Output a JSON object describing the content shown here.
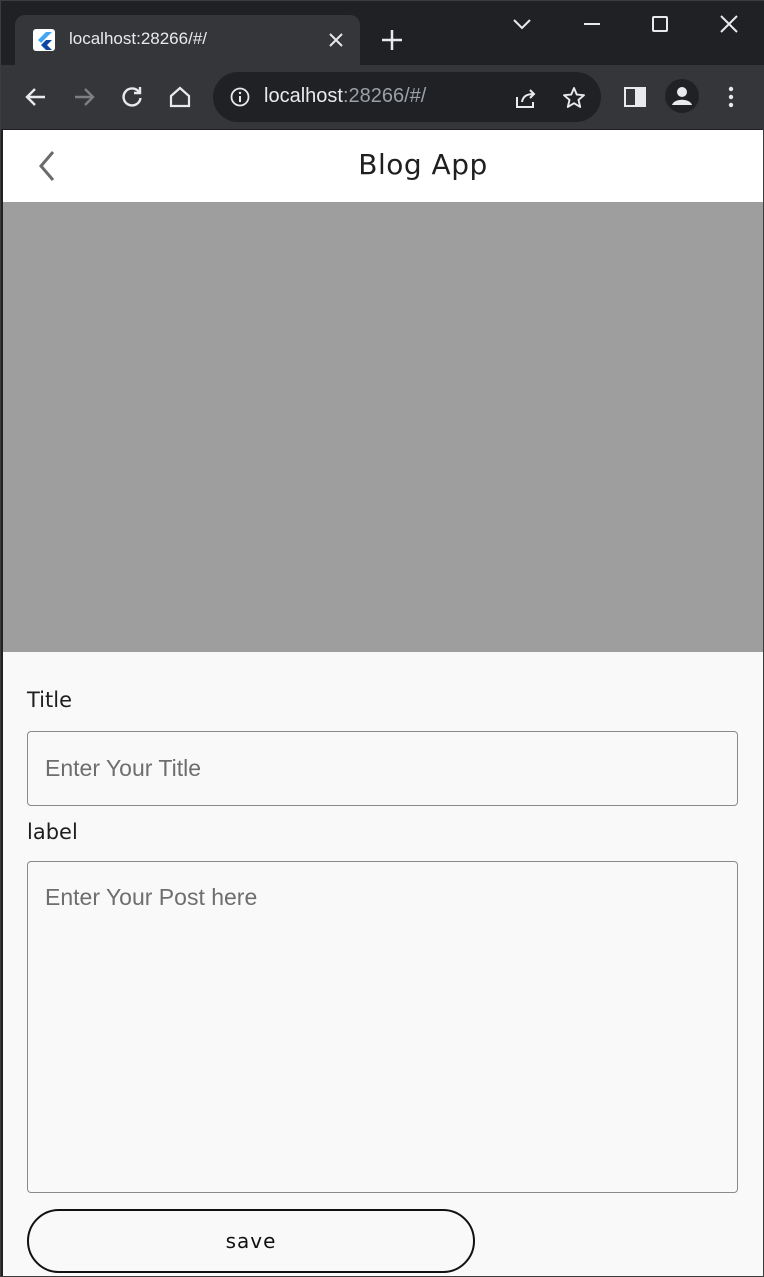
{
  "browser": {
    "tab": {
      "title": "localhost:28266/#/"
    },
    "omnibox": {
      "host": "localhost",
      "path": ":28266/#/"
    }
  },
  "icons": {
    "tab_favicon": "flutter-icon",
    "tab_close": "close-icon",
    "new_tab": "plus-icon",
    "tab_search": "chevron-down-icon",
    "minimize": "minimize-icon",
    "maximize": "maximize-icon",
    "close_window": "close-icon",
    "back": "arrow-left-icon",
    "forward": "arrow-right-icon",
    "reload": "reload-icon",
    "home": "home-icon",
    "site_info": "info-icon",
    "share": "share-icon",
    "bookmark": "star-icon",
    "side_panel": "side-panel-icon",
    "profile": "profile-icon",
    "menu": "kebab-menu-icon",
    "app_back": "chevron-left-icon"
  },
  "app": {
    "title": "Blog App",
    "form": {
      "title_label": "Title",
      "title_placeholder": "Enter Your Title",
      "post_label": "label",
      "post_placeholder": "Enter Your Post here",
      "save_label": "save"
    }
  },
  "colors": {
    "browser_frame": "#202124",
    "toolbar": "#35363a",
    "image_placeholder": "#9e9e9e",
    "page_background": "#f9f9f9"
  }
}
